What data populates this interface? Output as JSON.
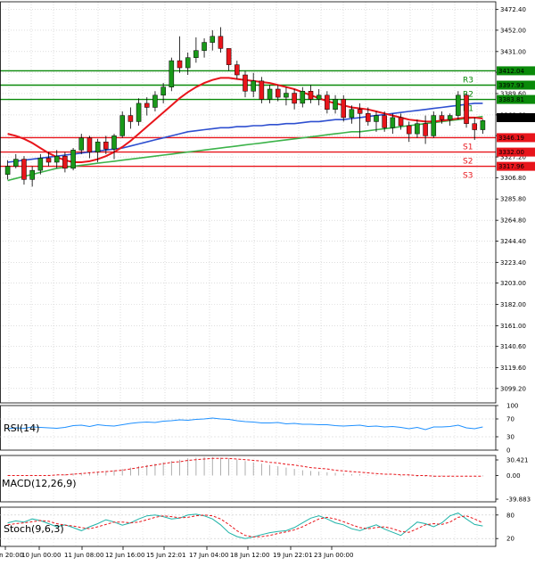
{
  "chart_data": {
    "type": "candlestick",
    "title": "",
    "xlabel": "",
    "ylabel": "",
    "ylim": [
      3085,
      3480
    ],
    "y_ticks": [
      "3472.40",
      "3452.00",
      "3431.00",
      "3410.60",
      "3389.60",
      "3368.60",
      "3348.20",
      "3327.20",
      "3306.80",
      "3285.80",
      "3264.80",
      "3244.40",
      "3223.40",
      "3203.00",
      "3182.00",
      "3161.00",
      "3140.60",
      "3119.60",
      "3099.20"
    ],
    "x_ticks": [
      "9 Jun 20:00",
      "10 Jun 00:00",
      "11 Jun 08:00",
      "12 Jun 16:00",
      "15 Jun 22:01",
      "17 Jun 04:00",
      "18 Jun 12:00",
      "19 Jun 22:01",
      "23 Jun 00:00"
    ],
    "grid": true,
    "legend": "none",
    "candles": [
      {
        "o": 3310,
        "h": 3324,
        "l": 3305,
        "c": 3318
      },
      {
        "o": 3318,
        "h": 3330,
        "l": 3316,
        "c": 3325
      },
      {
        "o": 3325,
        "h": 3328,
        "l": 3300,
        "c": 3305
      },
      {
        "o": 3305,
        "h": 3318,
        "l": 3298,
        "c": 3314
      },
      {
        "o": 3314,
        "h": 3330,
        "l": 3310,
        "c": 3326
      },
      {
        "o": 3326,
        "h": 3332,
        "l": 3318,
        "c": 3322
      },
      {
        "o": 3322,
        "h": 3334,
        "l": 3316,
        "c": 3328
      },
      {
        "o": 3328,
        "h": 3332,
        "l": 3312,
        "c": 3316
      },
      {
        "o": 3316,
        "h": 3336,
        "l": 3314,
        "c": 3334
      },
      {
        "o": 3334,
        "h": 3350,
        "l": 3330,
        "c": 3346
      },
      {
        "o": 3346,
        "h": 3348,
        "l": 3326,
        "c": 3332
      },
      {
        "o": 3332,
        "h": 3345,
        "l": 3322,
        "c": 3342
      },
      {
        "o": 3342,
        "h": 3348,
        "l": 3330,
        "c": 3335
      },
      {
        "o": 3335,
        "h": 3350,
        "l": 3325,
        "c": 3348
      },
      {
        "o": 3348,
        "h": 3372,
        "l": 3346,
        "c": 3368
      },
      {
        "o": 3368,
        "h": 3376,
        "l": 3355,
        "c": 3362
      },
      {
        "o": 3362,
        "h": 3385,
        "l": 3358,
        "c": 3380
      },
      {
        "o": 3380,
        "h": 3386,
        "l": 3368,
        "c": 3376
      },
      {
        "o": 3376,
        "h": 3392,
        "l": 3372,
        "c": 3388
      },
      {
        "o": 3388,
        "h": 3400,
        "l": 3380,
        "c": 3396
      },
      {
        "o": 3396,
        "h": 3425,
        "l": 3392,
        "c": 3422
      },
      {
        "o": 3422,
        "h": 3446,
        "l": 3410,
        "c": 3415
      },
      {
        "o": 3415,
        "h": 3430,
        "l": 3408,
        "c": 3425
      },
      {
        "o": 3425,
        "h": 3445,
        "l": 3420,
        "c": 3432
      },
      {
        "o": 3432,
        "h": 3444,
        "l": 3425,
        "c": 3440
      },
      {
        "o": 3440,
        "h": 3452,
        "l": 3432,
        "c": 3446
      },
      {
        "o": 3446,
        "h": 3455,
        "l": 3430,
        "c": 3434
      },
      {
        "o": 3434,
        "h": 3428,
        "l": 3412,
        "c": 3418
      },
      {
        "o": 3418,
        "h": 3422,
        "l": 3404,
        "c": 3408
      },
      {
        "o": 3408,
        "h": 3412,
        "l": 3386,
        "c": 3392
      },
      {
        "o": 3392,
        "h": 3410,
        "l": 3386,
        "c": 3402
      },
      {
        "o": 3402,
        "h": 3406,
        "l": 3380,
        "c": 3384
      },
      {
        "o": 3384,
        "h": 3398,
        "l": 3380,
        "c": 3394
      },
      {
        "o": 3394,
        "h": 3398,
        "l": 3382,
        "c": 3386
      },
      {
        "o": 3386,
        "h": 3396,
        "l": 3378,
        "c": 3390
      },
      {
        "o": 3390,
        "h": 3394,
        "l": 3374,
        "c": 3380
      },
      {
        "o": 3380,
        "h": 3396,
        "l": 3376,
        "c": 3392
      },
      {
        "o": 3392,
        "h": 3398,
        "l": 3380,
        "c": 3384
      },
      {
        "o": 3384,
        "h": 3394,
        "l": 3378,
        "c": 3388
      },
      {
        "o": 3388,
        "h": 3392,
        "l": 3370,
        "c": 3374
      },
      {
        "o": 3374,
        "h": 3388,
        "l": 3370,
        "c": 3384
      },
      {
        "o": 3384,
        "h": 3388,
        "l": 3362,
        "c": 3366
      },
      {
        "o": 3366,
        "h": 3378,
        "l": 3360,
        "c": 3374
      },
      {
        "o": 3374,
        "h": 3380,
        "l": 3346,
        "c": 3370
      },
      {
        "o": 3370,
        "h": 3376,
        "l": 3358,
        "c": 3362
      },
      {
        "o": 3362,
        "h": 3372,
        "l": 3352,
        "c": 3368
      },
      {
        "o": 3368,
        "h": 3372,
        "l": 3352,
        "c": 3356
      },
      {
        "o": 3356,
        "h": 3370,
        "l": 3350,
        "c": 3366
      },
      {
        "o": 3366,
        "h": 3370,
        "l": 3354,
        "c": 3358
      },
      {
        "o": 3358,
        "h": 3362,
        "l": 3342,
        "c": 3350
      },
      {
        "o": 3350,
        "h": 3364,
        "l": 3346,
        "c": 3360
      },
      {
        "o": 3360,
        "h": 3368,
        "l": 3340,
        "c": 3348
      },
      {
        "o": 3348,
        "h": 3372,
        "l": 3346,
        "c": 3368
      },
      {
        "o": 3368,
        "h": 3372,
        "l": 3360,
        "c": 3364
      },
      {
        "o": 3364,
        "h": 3370,
        "l": 3358,
        "c": 3368
      },
      {
        "o": 3368,
        "h": 3392,
        "l": 3364,
        "c": 3388
      },
      {
        "o": 3388,
        "h": 3390,
        "l": 3356,
        "c": 3360
      },
      {
        "o": 3360,
        "h": 3366,
        "l": 3344,
        "c": 3354
      },
      {
        "o": 3354,
        "h": 3364,
        "l": 3350,
        "c": 3363
      }
    ],
    "ma_red": [
      3350,
      3348,
      3345,
      3341,
      3336,
      3331,
      3327,
      3324,
      3322,
      3322,
      3323,
      3325,
      3328,
      3332,
      3337,
      3343,
      3350,
      3357,
      3364,
      3371,
      3378,
      3385,
      3391,
      3396,
      3400,
      3403,
      3405,
      3405,
      3404,
      3403,
      3402,
      3401,
      3400,
      3398,
      3396,
      3394,
      3391,
      3388,
      3385,
      3382,
      3380,
      3378,
      3376,
      3375,
      3374,
      3372,
      3370,
      3368,
      3366,
      3364,
      3363,
      3362,
      3362,
      3363,
      3364,
      3365,
      3366,
      3366,
      3365
    ],
    "ma_blue": [
      3322,
      3323,
      3324,
      3325,
      3326,
      3327,
      3328,
      3329,
      3330,
      3331,
      3332,
      3333,
      3334,
      3335,
      3336,
      3338,
      3340,
      3342,
      3344,
      3346,
      3348,
      3350,
      3352,
      3353,
      3354,
      3355,
      3356,
      3356,
      3357,
      3357,
      3358,
      3358,
      3359,
      3359,
      3360,
      3360,
      3361,
      3362,
      3362,
      3363,
      3364,
      3364,
      3365,
      3366,
      3367,
      3368,
      3369,
      3370,
      3371,
      3372,
      3373,
      3374,
      3375,
      3376,
      3377,
      3378,
      3379,
      3380,
      3380
    ],
    "ma_green": [
      3304,
      3306,
      3308,
      3310,
      3312,
      3314,
      3316,
      3317,
      3318,
      3319,
      3320,
      3321,
      3322,
      3323,
      3324,
      3325,
      3326,
      3327,
      3328,
      3329,
      3330,
      3331,
      3332,
      3333,
      3334,
      3335,
      3336,
      3337,
      3338,
      3339,
      3340,
      3341,
      3342,
      3343,
      3344,
      3345,
      3346,
      3347,
      3348,
      3349,
      3350,
      3351,
      3352,
      3352,
      3353,
      3354,
      3355,
      3356,
      3357,
      3358,
      3359,
      3360,
      3361,
      3362,
      3363,
      3364,
      3365,
      3366,
      3367
    ],
    "levels": [
      {
        "name": "R3",
        "value": 3412.04,
        "label": "3412.04",
        "color": "#0a8a0a"
      },
      {
        "name": "R2",
        "value": 3397.93,
        "label": "3397.93",
        "color": "#0a8a0a"
      },
      {
        "name": "R1",
        "value": 3383.81,
        "label": "3383.81",
        "color": "#0a8a0a"
      },
      {
        "name": "S1",
        "value": 3346.19,
        "label": "3346.19",
        "color": "#e8151b"
      },
      {
        "name": "S2",
        "value": 3332.0,
        "label": "3332.00",
        "color": "#e8151b"
      },
      {
        "name": "S3",
        "value": 3317.96,
        "label": "3317.96",
        "color": "#e8151b"
      }
    ],
    "current_price": {
      "value": 3365.89,
      "label": "3365.89"
    },
    "rsi": {
      "label": "RSI(14)",
      "ticks": [
        "100",
        "70",
        "30",
        "0"
      ],
      "values": [
        48,
        50,
        49,
        52,
        51,
        50,
        49,
        51,
        55,
        56,
        53,
        57,
        55,
        54,
        57,
        60,
        62,
        63,
        62,
        65,
        66,
        68,
        67,
        69,
        70,
        72,
        70,
        69,
        66,
        64,
        63,
        61,
        61,
        62,
        59,
        60,
        58,
        58,
        57,
        57,
        55,
        54,
        55,
        56,
        53,
        54,
        52,
        53,
        51,
        48,
        51,
        46,
        52,
        52,
        53,
        56,
        50,
        48,
        52
      ]
    },
    "macd": {
      "label": "MACD(12,26,9)",
      "ticks": [
        "30.421",
        "0.00",
        "-39.883"
      ],
      "hist": [
        0,
        0,
        0,
        0,
        0,
        1,
        1,
        2,
        3,
        4,
        5,
        6,
        7,
        8,
        10,
        12,
        14,
        16,
        18,
        20,
        22,
        24,
        26,
        27,
        28,
        28,
        27,
        26,
        24,
        22,
        20,
        18,
        16,
        14,
        12,
        10,
        8,
        7,
        6,
        5,
        4,
        3,
        2,
        2,
        1,
        1,
        0,
        0,
        -1,
        -1,
        -2,
        -2,
        -2,
        -1,
        -1,
        0,
        -1,
        -1,
        -1
      ],
      "signal": [
        0,
        0,
        0,
        0,
        0,
        0,
        1,
        1,
        2,
        3,
        4,
        5,
        6,
        7,
        8,
        10,
        12,
        14,
        16,
        18,
        20,
        21,
        23,
        24,
        25,
        26,
        26,
        26,
        25,
        24,
        23,
        22,
        20,
        19,
        17,
        16,
        14,
        12,
        11,
        10,
        8,
        7,
        6,
        5,
        4,
        3,
        2,
        2,
        1,
        1,
        0,
        0,
        -1,
        -1,
        -1,
        -1,
        -1,
        -1,
        -1
      ]
    },
    "stoch": {
      "label": "Stoch(9,6,3)",
      "ticks": [
        "80",
        "20"
      ],
      "k": [
        60,
        65,
        62,
        70,
        66,
        58,
        50,
        55,
        48,
        40,
        50,
        58,
        68,
        62,
        54,
        60,
        70,
        78,
        80,
        76,
        70,
        72,
        80,
        82,
        78,
        70,
        55,
        35,
        25,
        20,
        24,
        30,
        35,
        38,
        40,
        48,
        60,
        72,
        78,
        70,
        60,
        55,
        45,
        40,
        48,
        55,
        44,
        36,
        28,
        45,
        62,
        58,
        50,
        60,
        78,
        85,
        70,
        56,
        52
      ],
      "d": [
        55,
        58,
        60,
        63,
        66,
        64,
        58,
        54,
        52,
        48,
        45,
        50,
        56,
        62,
        62,
        60,
        62,
        68,
        74,
        78,
        76,
        73,
        74,
        78,
        80,
        78,
        70,
        56,
        40,
        28,
        24,
        25,
        28,
        33,
        37,
        42,
        50,
        60,
        70,
        74,
        70,
        63,
        55,
        48,
        45,
        48,
        50,
        45,
        38,
        36,
        45,
        55,
        58,
        56,
        62,
        74,
        78,
        70,
        60
      ]
    }
  }
}
